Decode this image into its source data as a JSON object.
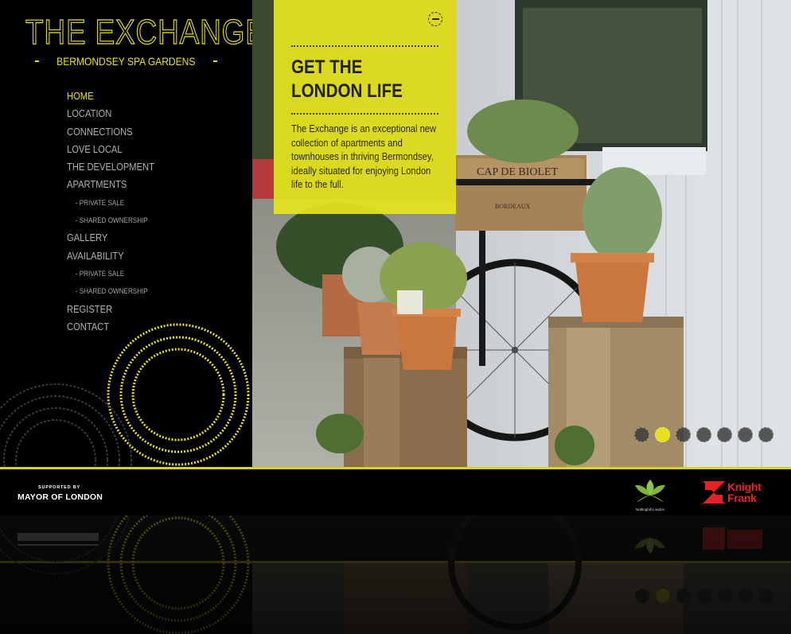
{
  "brand": {
    "title": "THE EXCHANGE",
    "subtitle": "BERMONDSEY SPA GARDENS",
    "accent_color": "#e6e021"
  },
  "nav": {
    "items": [
      {
        "label": "HOME",
        "active": true
      },
      {
        "label": "LOCATION"
      },
      {
        "label": "CONNECTIONS"
      },
      {
        "label": "LOVE LOCAL"
      },
      {
        "label": "THE DEVELOPMENT"
      },
      {
        "label": "APARTMENTS"
      },
      {
        "label": "- PRIVATE SALE",
        "sub": true
      },
      {
        "label": "- SHARED OWNERSHIP",
        "sub": true
      },
      {
        "label": "GALLERY"
      },
      {
        "label": "AVAILABILITY"
      },
      {
        "label": "- PRIVATE SALE",
        "sub": true
      },
      {
        "label": "- SHARED OWNERSHIP",
        "sub": true
      },
      {
        "label": "REGISTER"
      },
      {
        "label": "CONTACT"
      }
    ]
  },
  "hero": {
    "heading_line1": "GET THE",
    "heading_line2": "LONDON LIFE",
    "body": "The Exchange is an exceptional new collection of apartments and townhouses in thriving Bermondsey, ideally situated for enjoying London life to the full.",
    "menu_icon": "minus-circle-icon",
    "crate_text_1": "CAP DE BIOLET",
    "crate_text_2": "BORDEAUX",
    "slides_total": 7,
    "active_slide": 2
  },
  "footer": {
    "supported_by": "SUPPORTED BY",
    "mayor": "MAYOR OF LONDON",
    "nh_caption": "Nottinghill London",
    "kf_line1": "Knight",
    "kf_line2": "Frank",
    "kf_color": "#e42228",
    "nh_color": "#8dc63f"
  }
}
